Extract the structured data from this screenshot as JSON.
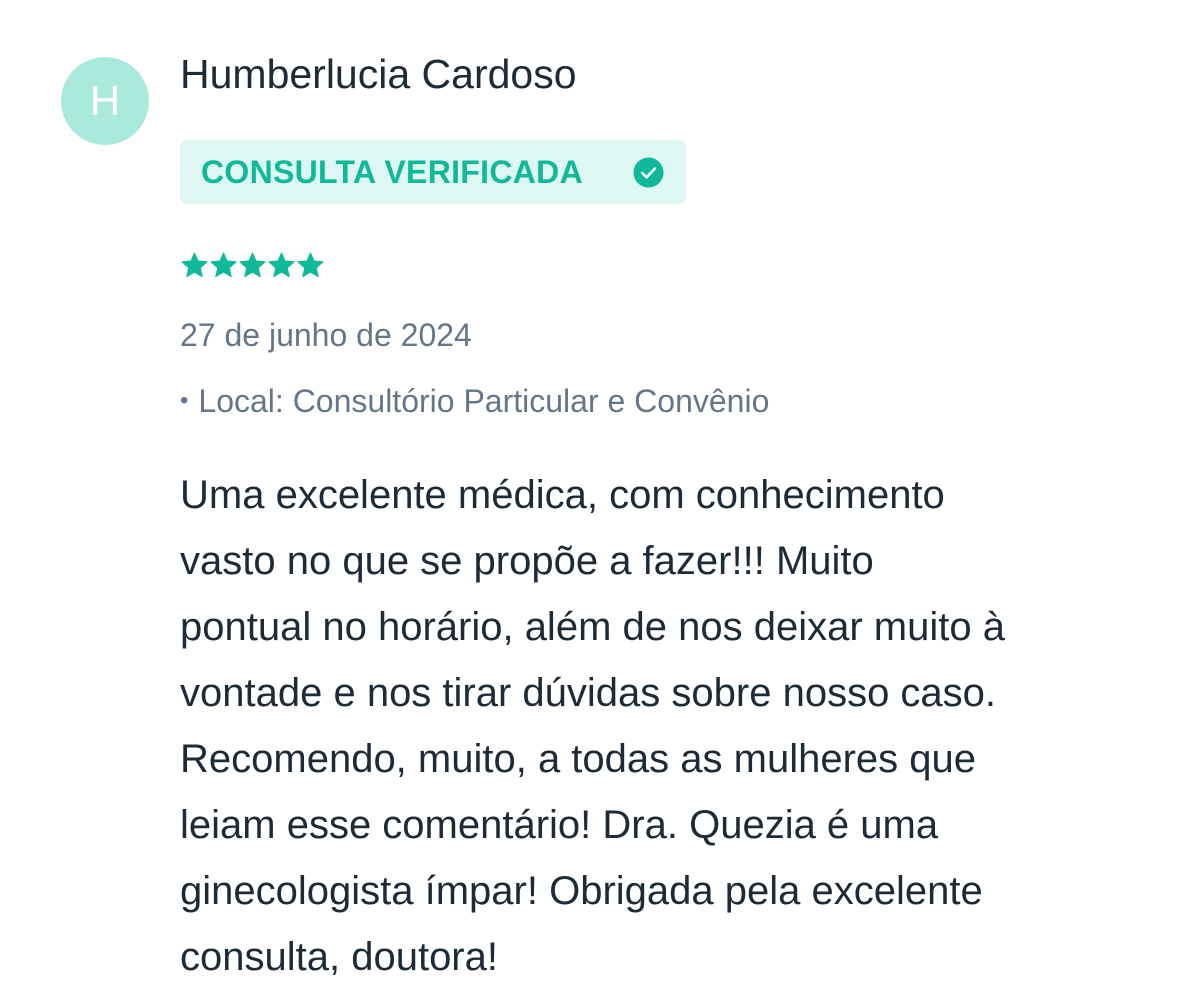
{
  "review": {
    "avatar_initial": "H",
    "author": "Humberlucia Cardoso",
    "badge": {
      "label": "CONSULTA VERIFICADA",
      "icon": "check-circle-icon",
      "color": "#0fb99a",
      "background": "#dff7f2"
    },
    "rating": {
      "stars": 5,
      "max": 5,
      "icon": "star-icon",
      "color": "#0fb99a"
    },
    "date": "27 de junho de 2024",
    "location_bullet": "•",
    "location": "Local: Consultório Particular e Convênio",
    "text_lines": [
      "Uma excelente médica, com conhecimento",
      "vasto no que se propõe a fazer!!! Muito",
      "pontual no horário, além de nos deixar muito à",
      "vontade e nos tirar dúvidas sobre nosso caso.",
      "Recomendo, muito, a todas as mulheres que",
      "leiam esse comentário! Dra. Quezia é uma",
      "ginecologista ímpar! Obrigada pela excelente",
      "consulta, doutora!"
    ]
  },
  "colors": {
    "avatar_bg": "#a9eadc",
    "text_primary": "#1f2a37",
    "text_secondary": "#66768a",
    "accent": "#0fb99a"
  }
}
